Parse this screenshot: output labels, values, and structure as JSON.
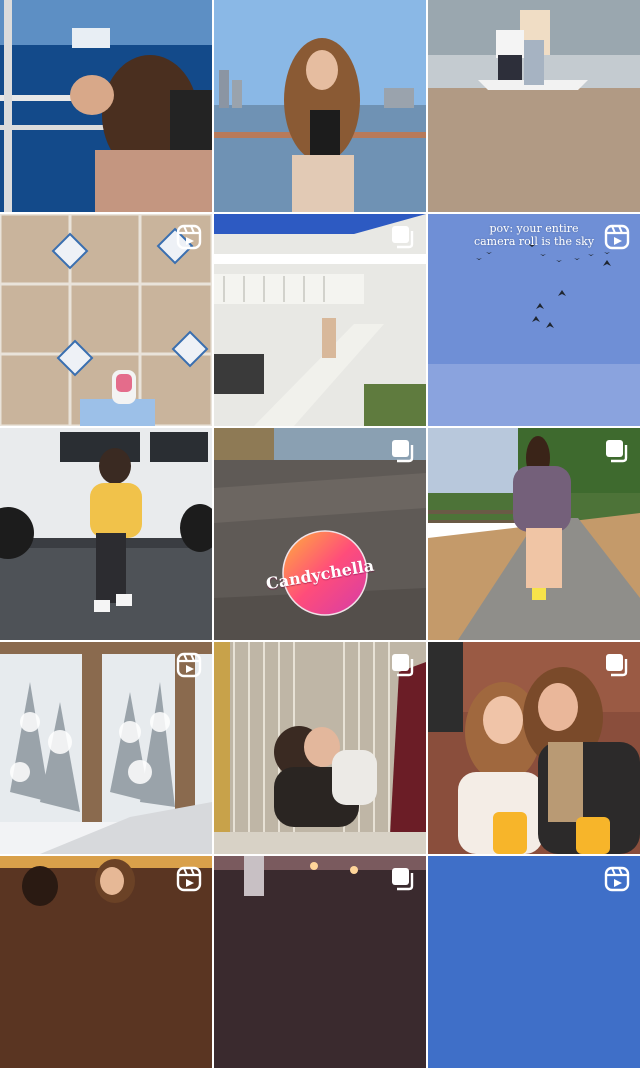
{
  "feed": {
    "posts": [
      {
        "id": "p1",
        "type": "photo",
        "scene": "ship-deck"
      },
      {
        "id": "p2",
        "type": "photo",
        "scene": "skyline-portrait"
      },
      {
        "id": "p3",
        "type": "photo",
        "scene": "beach-proposal"
      },
      {
        "id": "p4",
        "type": "reel",
        "scene": "tile-floor"
      },
      {
        "id": "p5",
        "type": "carousel",
        "scene": "white-house-stairs"
      },
      {
        "id": "p6",
        "type": "reel",
        "scene": "sky-birds",
        "caption": "pov: your entire\ncamera roll is the sky"
      },
      {
        "id": "p7",
        "type": "photo",
        "scene": "white-jeep"
      },
      {
        "id": "p8",
        "type": "carousel",
        "scene": "sticker-on-rock",
        "sticker_text": "Candychella"
      },
      {
        "id": "p9",
        "type": "carousel",
        "scene": "walking-path"
      },
      {
        "id": "p10",
        "type": "reel",
        "scene": "snowy-window"
      },
      {
        "id": "p11",
        "type": "carousel",
        "scene": "tinsel-hug"
      },
      {
        "id": "p12",
        "type": "carousel",
        "scene": "brunch-friends"
      },
      {
        "id": "p13",
        "type": "reel",
        "scene": "restaurant-group"
      },
      {
        "id": "p14",
        "type": "carousel",
        "scene": "night-lights"
      },
      {
        "id": "p15",
        "type": "reel",
        "scene": "blue-sky"
      }
    ]
  },
  "icons": {
    "reel": "reel-icon",
    "carousel": "carousel-icon"
  },
  "colors": {
    "badge": "#ffffff",
    "grid_gap": "#ffffff"
  }
}
